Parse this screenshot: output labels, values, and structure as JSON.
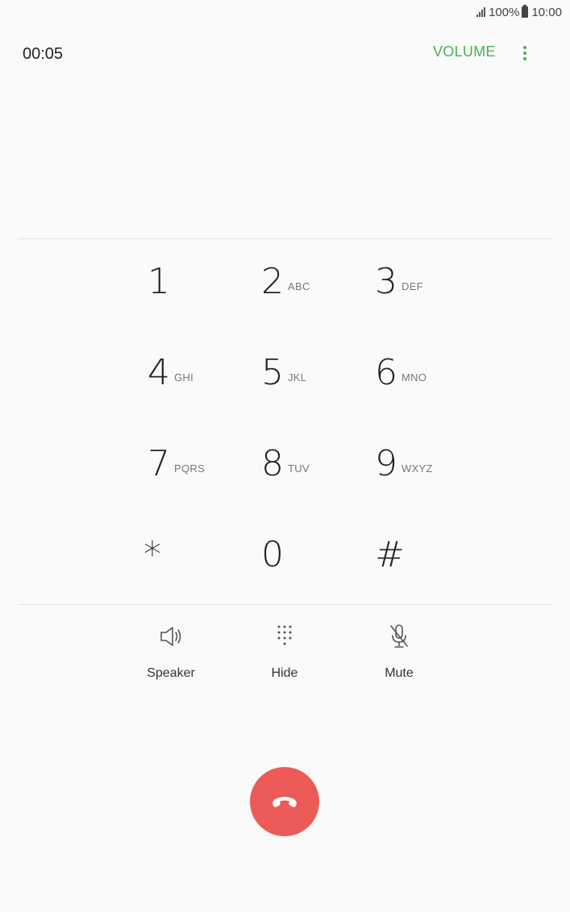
{
  "status_bar": {
    "battery_text": "100%",
    "time": "10:00"
  },
  "call": {
    "timer": "00:05",
    "volume_label": "VOLUME"
  },
  "keypad": [
    {
      "digit": "1",
      "letters": ""
    },
    {
      "digit": "2",
      "letters": "ABC"
    },
    {
      "digit": "3",
      "letters": "DEF"
    },
    {
      "digit": "4",
      "letters": "GHI"
    },
    {
      "digit": "5",
      "letters": "JKL"
    },
    {
      "digit": "6",
      "letters": "MNO"
    },
    {
      "digit": "7",
      "letters": "PQRS"
    },
    {
      "digit": "8",
      "letters": "TUV"
    },
    {
      "digit": "9",
      "letters": "WXYZ"
    },
    {
      "digit": "*",
      "letters": ""
    },
    {
      "digit": "0",
      "letters": ""
    },
    {
      "digit": "#",
      "letters": ""
    }
  ],
  "actions": {
    "speaker": {
      "label": "Speaker",
      "icon": "speaker-icon"
    },
    "hide": {
      "label": "Hide",
      "icon": "keypad-icon"
    },
    "mute": {
      "label": "Mute",
      "icon": "mic-off-icon"
    }
  },
  "end_call": {
    "icon": "end-call-icon",
    "color": "#ec5b57"
  },
  "colors": {
    "accent": "#4caf50",
    "background": "#fafafa"
  }
}
